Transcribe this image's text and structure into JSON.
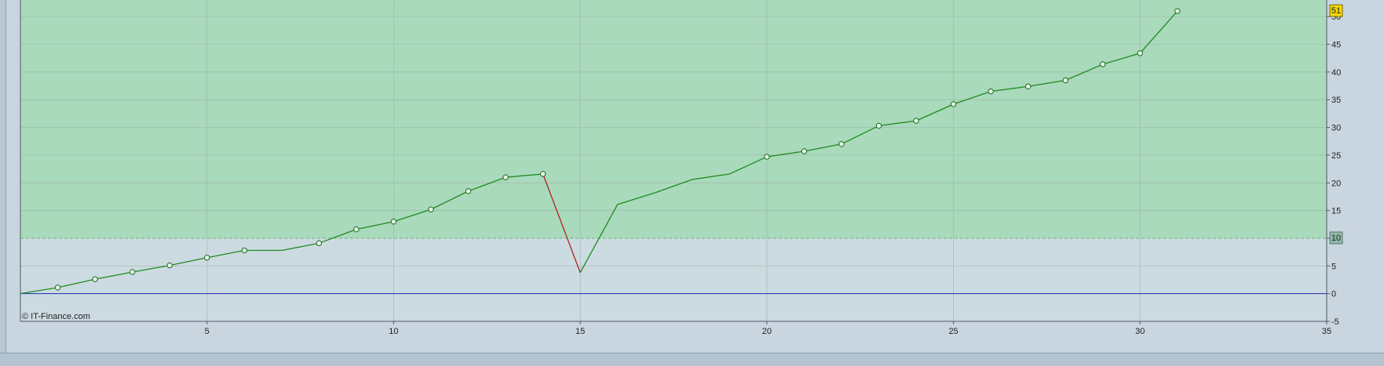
{
  "copyright": "© IT-Finance.com",
  "colors": {
    "upper_zone": "#a9dabb",
    "lower_zone": "#ccdbe2",
    "grid": "#9fb8a9",
    "line_up": "#1f8a1f",
    "line_down": "#b02020",
    "zero_line": "#1a2ab0",
    "threshold": "#6fb07f",
    "last_badge": "#f4d800",
    "threshold_badge": "#8fb8a8"
  },
  "chart_data": {
    "type": "line",
    "xlim": [
      0,
      35
    ],
    "ylim": [
      -5,
      53
    ],
    "x_ticks": [
      5,
      10,
      15,
      20,
      25,
      30,
      35
    ],
    "y_ticks": [
      -5,
      0,
      5,
      10,
      15,
      20,
      25,
      30,
      35,
      40,
      45,
      50
    ],
    "threshold": 10,
    "last_value_label": "51",
    "threshold_label": "10",
    "grid": true,
    "series": [
      {
        "x": [
          0,
          1,
          2,
          3,
          4,
          5,
          6,
          7,
          8,
          9,
          10,
          11,
          12,
          13,
          14,
          15,
          16,
          17,
          18,
          19,
          20,
          21,
          22,
          23,
          24,
          25,
          26,
          27,
          28,
          29,
          30,
          31
        ],
        "y": [
          0,
          1.1,
          2.6,
          3.9,
          5.1,
          6.5,
          7.8,
          7.8,
          9.1,
          11.6,
          13.0,
          15.2,
          18.5,
          21.0,
          21.6,
          3.8,
          16.1,
          18.2,
          20.6,
          21.6,
          24.7,
          25.7,
          27.0,
          30.3,
          31.2,
          34.2,
          36.5,
          37.4,
          38.5,
          41.4,
          43.4,
          51.0
        ],
        "markers": [
          false,
          true,
          true,
          true,
          true,
          true,
          true,
          false,
          true,
          true,
          true,
          true,
          true,
          true,
          true,
          false,
          false,
          false,
          false,
          false,
          true,
          true,
          true,
          true,
          true,
          true,
          true,
          true,
          true,
          true,
          true,
          true
        ]
      }
    ]
  }
}
